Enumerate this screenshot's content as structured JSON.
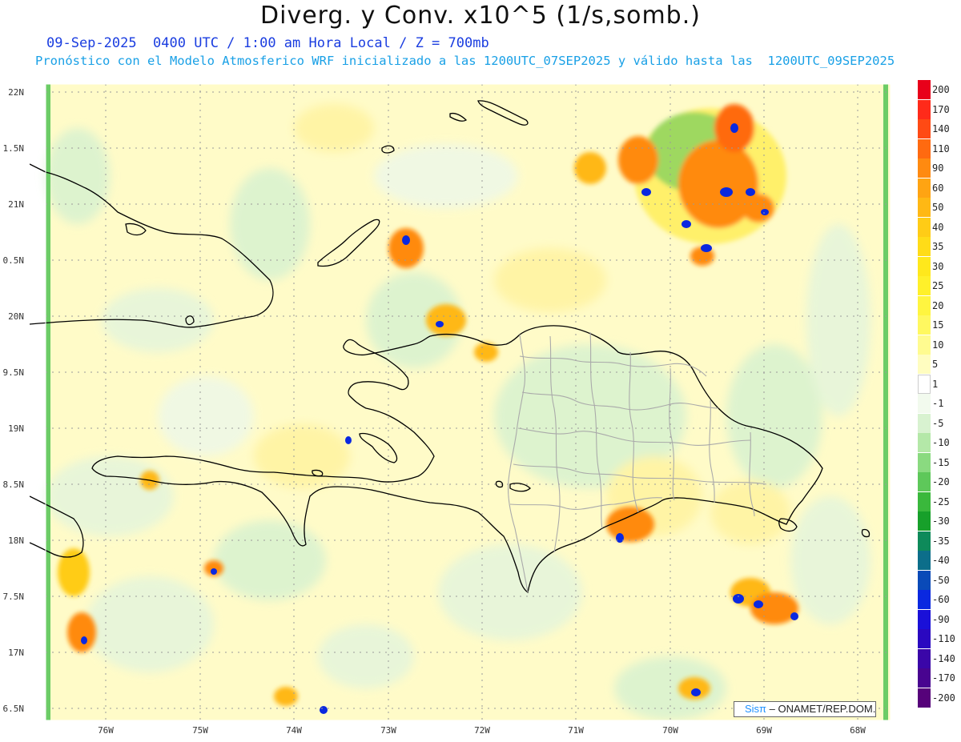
{
  "title": "Diverg. y Conv. x10^5 (1/s,somb.)",
  "subtitle_time": "09-Sep-2025  0400 UTC / 1:00 am Hora Local / Z = 700mb",
  "subtitle_model": "Pronóstico con el Modelo Atmosferico WRF inicializado a las 1200UTC_07SEP2025 y válido hasta las  1200UTC_09SEP2025",
  "lat_labels": [
    "22N",
    "1.5N",
    "21N",
    "0.5N",
    "20N",
    "9.5N",
    "19N",
    "8.5N",
    "18N",
    "7.5N",
    "17N",
    "6.5N"
  ],
  "lon_labels": [
    "76W",
    "75W",
    "74W",
    "73W",
    "72W",
    "71W",
    "70W",
    "69W",
    "68W"
  ],
  "colorbar": {
    "labels": [
      "200",
      "170",
      "140",
      "110",
      "90",
      "60",
      "50",
      "40",
      "35",
      "30",
      "25",
      "20",
      "15",
      "10",
      "5",
      "1",
      "-1",
      "-5",
      "-10",
      "-15",
      "-20",
      "-25",
      "-30",
      "-35",
      "-40",
      "-50",
      "-60",
      "-90",
      "-110",
      "-140",
      "-170",
      "-200"
    ],
    "colors": [
      "#e8001a",
      "#ff2a1a",
      "#ff4a14",
      "#ff6a10",
      "#ff8a10",
      "#ffa412",
      "#ffb814",
      "#ffcc16",
      "#ffdc18",
      "#ffe81c",
      "#fff02a",
      "#fff540",
      "#fff860",
      "#fffb90",
      "#fffdc0",
      "#ffffff",
      "#f2faee",
      "#d8f2d0",
      "#b4e8a8",
      "#8ada80",
      "#5ec85a",
      "#3ab83c",
      "#17a02a",
      "#0e8a5a",
      "#0c6e8a",
      "#0a4ab8",
      "#0a28e0",
      "#1a10d8",
      "#2a08c0",
      "#3a06a8",
      "#480490",
      "#56027a"
    ]
  },
  "credit": {
    "brand": "Sisπ",
    "text": "– ONAMET/REP.DOM."
  }
}
